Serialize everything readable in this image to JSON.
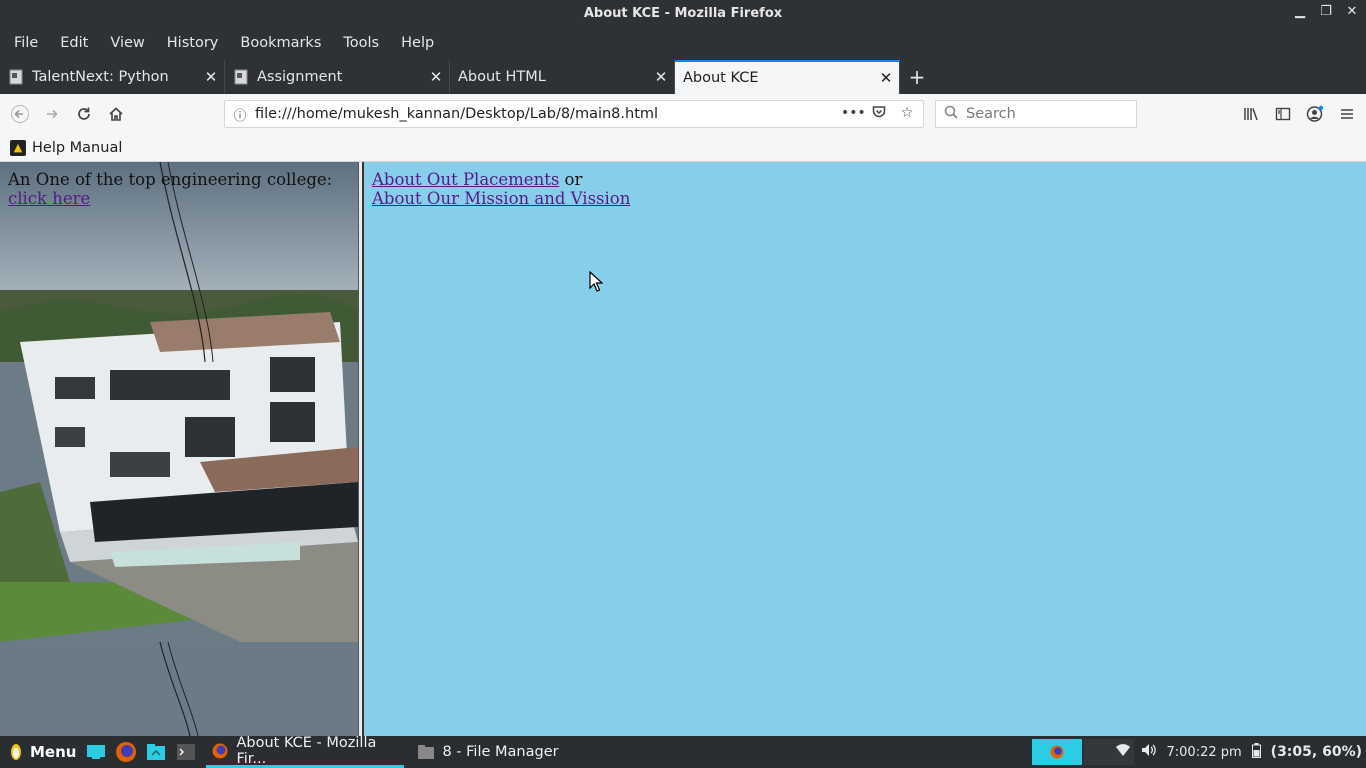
{
  "window": {
    "title": "About KCE - Mozilla Firefox"
  },
  "menubar": {
    "items": [
      "File",
      "Edit",
      "View",
      "History",
      "Bookmarks",
      "Tools",
      "Help"
    ]
  },
  "tabs": [
    {
      "label": "TalentNext: Python",
      "icon": "document-icon",
      "active": false
    },
    {
      "label": "Assignment",
      "icon": "document-icon",
      "active": false
    },
    {
      "label": "About HTML",
      "icon": "",
      "active": false
    },
    {
      "label": "About KCE",
      "icon": "",
      "active": true
    }
  ],
  "navbar": {
    "url": "file:///home/mukesh_kannan/Desktop/Lab/8/main8.html",
    "search_placeholder": "Search"
  },
  "bookmarks": {
    "items": [
      {
        "label": "Help Manual"
      }
    ]
  },
  "content": {
    "left": {
      "text": "An One of the top engineering college:",
      "link": "click here"
    },
    "right": {
      "link1": "About Out Placements",
      "or_text": " or",
      "link2": "About Our Mission and Vission",
      "background": "#87ceeb"
    }
  },
  "taskbar": {
    "menu_label": "Menu",
    "tasks": [
      {
        "label": "About KCE - Mozilla Fir...",
        "active": true
      },
      {
        "label": "8 - File Manager",
        "active": false
      }
    ],
    "clock": "7:00:22 pm",
    "battery": "(3:05, 60%)"
  }
}
